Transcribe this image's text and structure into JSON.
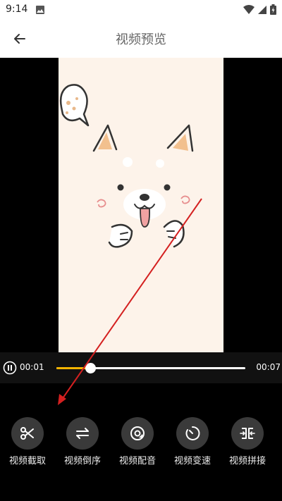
{
  "status": {
    "time": "9:14"
  },
  "header": {
    "title": "视频预览"
  },
  "player": {
    "current_time": "00:01",
    "total_time": "00:07",
    "progress_percent": 18
  },
  "tools": [
    {
      "label": "视频截取",
      "icon": "scissors-icon"
    },
    {
      "label": "视频倒序",
      "icon": "swap-arrows-icon"
    },
    {
      "label": "视频配音",
      "icon": "music-disc-icon"
    },
    {
      "label": "视频变速",
      "icon": "timer-icon"
    },
    {
      "label": "视频拼接",
      "icon": "merge-icon"
    }
  ],
  "colors": {
    "accent": "#f5b400",
    "annotation": "#d42020",
    "video_bg": "#fdf3ea"
  }
}
